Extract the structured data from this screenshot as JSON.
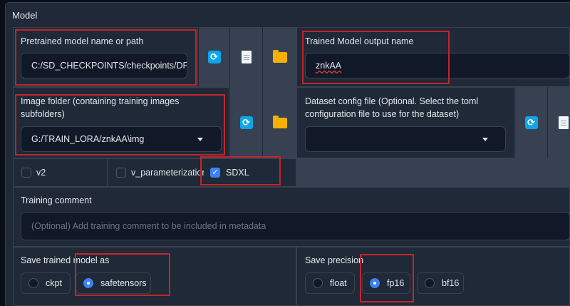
{
  "section": {
    "title": "Model"
  },
  "pretrained": {
    "label": "Pretrained model name or path",
    "value": "C:/SD_CHECKPOINTS/checkpoints/DF"
  },
  "output_name": {
    "label": "Trained Model output name",
    "value": "znkAA"
  },
  "image_folder": {
    "label_line1": "Image folder (containing training images",
    "label_line2": "subfolders)",
    "value": "G:/TRAIN_LORA/znkAA\\img"
  },
  "dataset_config": {
    "label_line1": "Dataset config file (Optional. Select the toml",
    "label_line2": "configuration file to use for the dataset)",
    "value": ""
  },
  "checkboxes": {
    "v2": {
      "label": "v2",
      "checked": false
    },
    "v_param": {
      "label": "v_parameterization",
      "checked": false
    },
    "sdxl": {
      "label": "SDXL",
      "checked": true
    }
  },
  "training_comment": {
    "label": "Training comment",
    "placeholder": "(Optional) Add training comment to be included in metadata"
  },
  "save_model_as": {
    "label": "Save trained model as",
    "options": [
      "ckpt",
      "safetensors"
    ],
    "selected": "safetensors"
  },
  "save_precision": {
    "label": "Save precision",
    "options": [
      "float",
      "fp16",
      "bf16"
    ],
    "selected": "fp16"
  },
  "icons": {
    "refresh": "refresh-icon",
    "document": "document-icon",
    "folder": "folder-icon"
  },
  "colors": {
    "accent": "#3b82f6",
    "highlight": "#c0262d",
    "refresh": "#0ea5e9",
    "folder": "#f5b000"
  }
}
